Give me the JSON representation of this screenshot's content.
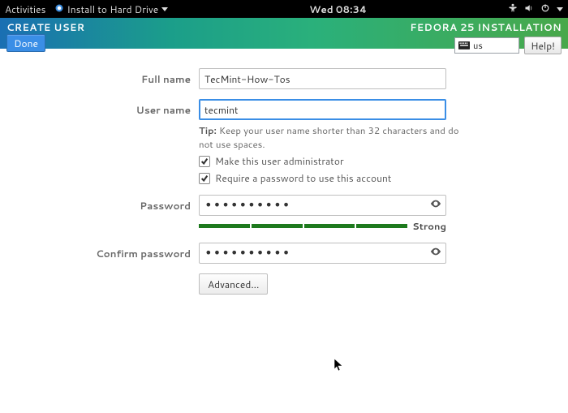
{
  "topbar": {
    "activities": "Activities",
    "app_name": "Install to Hard Drive",
    "clock": "Wed 08:34"
  },
  "header": {
    "title": "CREATE USER",
    "done": "Done",
    "brand": "FEDORA 25 INSTALLATION",
    "kb_layout": "us",
    "help": "Help!"
  },
  "form": {
    "fullname_label": "Full name",
    "fullname_value": "TecMint-How-Tos",
    "username_label": "User name",
    "username_value": "tecmint",
    "tip_prefix": "Tip:",
    "tip_text": " Keep your user name shorter than 32 characters and do not use spaces.",
    "admin_label": "Make this user administrator",
    "require_pw_label": "Require a password to use this account",
    "password_label": "Password",
    "password_masked": "••••••••••",
    "strength_label": "Strong",
    "confirm_label": "Confirm password",
    "confirm_masked": "••••••••••",
    "advanced_label": "Advanced..."
  },
  "state": {
    "admin_checked": true,
    "require_pw_checked": true
  }
}
